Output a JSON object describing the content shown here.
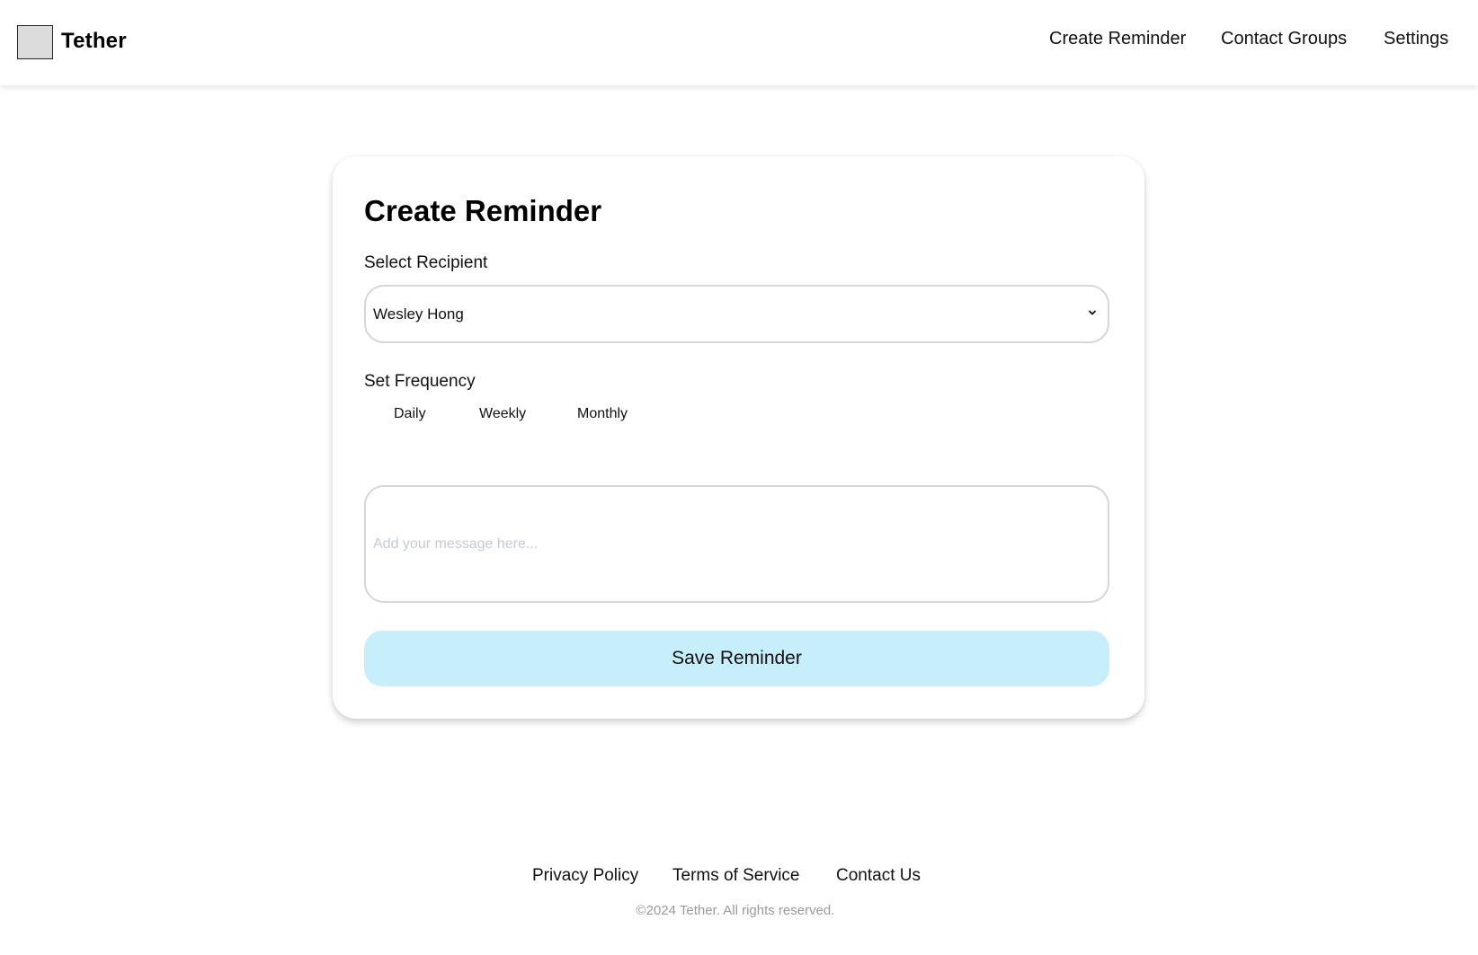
{
  "header": {
    "brand": "Tether",
    "nav": [
      "Create Reminder",
      "Contact Groups",
      "Settings"
    ]
  },
  "form": {
    "title": "Create Reminder",
    "recipient_label": "Select Recipient",
    "recipient_value": "Wesley Hong",
    "frequency_label": "Set Frequency",
    "frequency_options": [
      "Daily",
      "Weekly",
      "Monthly"
    ],
    "message_placeholder": "Add your message here...",
    "save_label": "Save Reminder"
  },
  "footer": {
    "links": [
      "Privacy Policy",
      "Terms of Service",
      "Contact Us"
    ],
    "copyright": "©2024 Tether. All rights reserved."
  },
  "colors": {
    "accent": "#c6effb",
    "border": "#d6d6d6",
    "muted": "#9a9a9a"
  },
  "icons": {
    "logo": "logo-placeholder",
    "select_arrow": "chevron-down-icon"
  }
}
